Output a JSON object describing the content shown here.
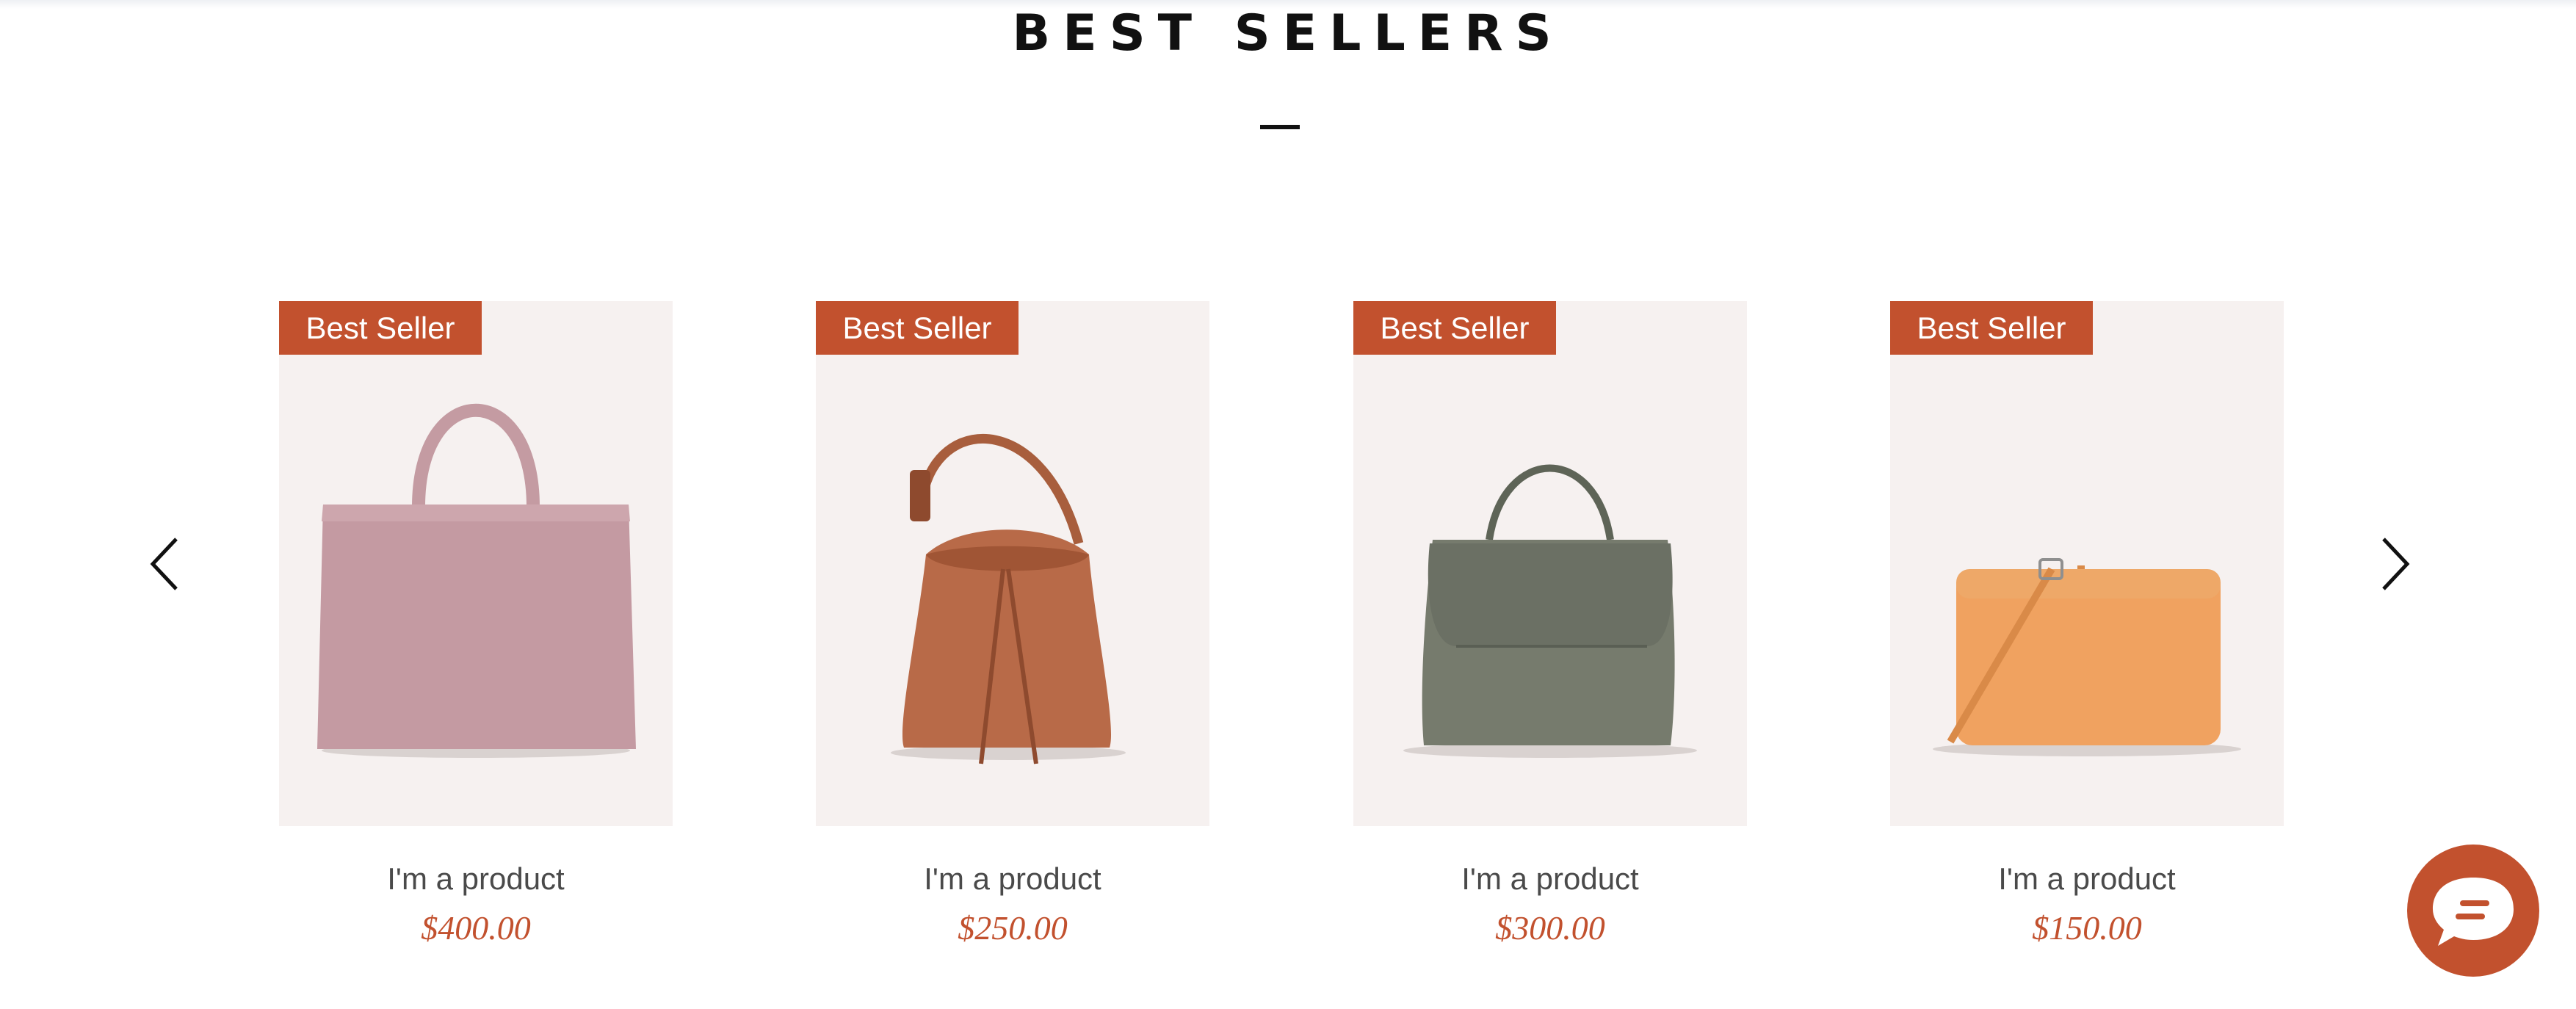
{
  "section": {
    "title": "BEST SELLERS"
  },
  "products": [
    {
      "badge": "Best Seller",
      "name": "I'm a product",
      "price": "$400.00",
      "icon": "pink-tote-bag-image"
    },
    {
      "badge": "Best Seller",
      "name": "I'm a product",
      "price": "$250.00",
      "icon": "brown-bucket-bag-image"
    },
    {
      "badge": "Best Seller",
      "name": "I'm a product",
      "price": "$300.00",
      "icon": "olive-top-handle-bag-image"
    },
    {
      "badge": "Best Seller",
      "name": "I'm a product",
      "price": "$150.00",
      "icon": "orange-crossbody-bag-image"
    }
  ],
  "icons": {
    "prev": "chevron-left-icon",
    "next": "chevron-right-icon",
    "chat": "chat-bubble-icon"
  },
  "colors": {
    "accent": "#c2512e",
    "card_background": "#f6f1f0",
    "title": "#111111",
    "product_name": "#4a4a4a"
  }
}
